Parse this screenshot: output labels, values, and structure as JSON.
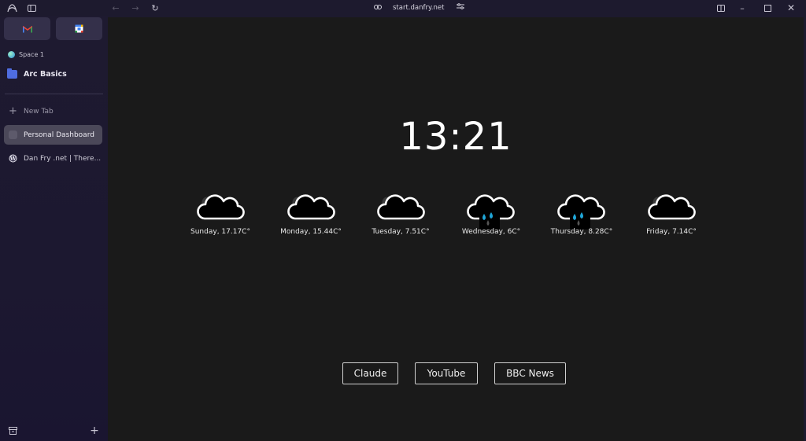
{
  "browser": {
    "url": "start.danfry.net"
  },
  "sidebar": {
    "space_name": "Space 1",
    "folder": "Arc Basics",
    "new_tab": "New Tab",
    "tabs": [
      {
        "label": "Personal Dashboard"
      },
      {
        "label": "Dan Fry .net | There..."
      }
    ]
  },
  "dashboard": {
    "time": "13:21",
    "forecast": [
      {
        "label": "Sunday, 17.17C°",
        "icon": "cloud-icon"
      },
      {
        "label": "Monday, 15.44C°",
        "icon": "cloud-icon"
      },
      {
        "label": "Tuesday, 7.51C°",
        "icon": "cloud-icon"
      },
      {
        "label": "Wednesday, 6C°",
        "icon": "rain-cloud-icon"
      },
      {
        "label": "Thursday, 8.28C°",
        "icon": "rain-cloud-icon"
      },
      {
        "label": "Friday, 7.14C°",
        "icon": "cloud-icon"
      }
    ],
    "links": [
      {
        "label": "Claude"
      },
      {
        "label": "YouTube"
      },
      {
        "label": "BBC News"
      }
    ]
  },
  "colors": {
    "sidebar_bg": "#1d1a2e",
    "content_bg": "#1a1a1a",
    "rain_drop": "#1fa6d8"
  }
}
